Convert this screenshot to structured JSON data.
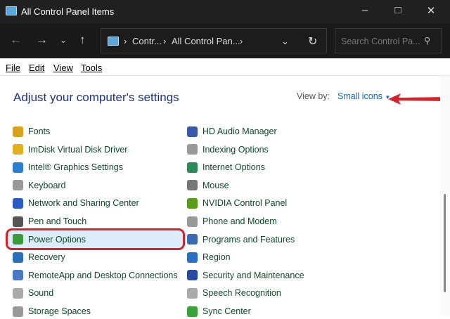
{
  "window": {
    "title": "All Control Panel Items"
  },
  "address": {
    "crumbs": [
      "Contr...",
      "All Control Pan..."
    ],
    "search_placeholder": "Search Control Pa..."
  },
  "menu": [
    "File",
    "Edit",
    "View",
    "Tools"
  ],
  "content": {
    "heading": "Adjust your computer's settings",
    "view_by_label": "View by:",
    "view_by_value": "Small icons"
  },
  "left_items": [
    {
      "label": "Fonts",
      "icon": "fonts-icon",
      "color": "#d9a21c"
    },
    {
      "label": "ImDisk Virtual Disk Driver",
      "icon": "imdisk-icon",
      "color": "#e0b020"
    },
    {
      "label": "Intel® Graphics Settings",
      "icon": "intel-graphics-icon",
      "color": "#2b7fd0"
    },
    {
      "label": "Keyboard",
      "icon": "keyboard-icon",
      "color": "#999999"
    },
    {
      "label": "Network and Sharing Center",
      "icon": "network-icon",
      "color": "#2a5bc0"
    },
    {
      "label": "Pen and Touch",
      "icon": "pen-icon",
      "color": "#555555"
    },
    {
      "label": "Power Options",
      "icon": "power-options-icon",
      "color": "#3c9a3c"
    },
    {
      "label": "Recovery",
      "icon": "recovery-icon",
      "color": "#2a70b8"
    },
    {
      "label": "RemoteApp and Desktop Connections",
      "icon": "remoteapp-icon",
      "color": "#4a7ac0"
    },
    {
      "label": "Sound",
      "icon": "sound-icon",
      "color": "#aaaaaa"
    },
    {
      "label": "Storage Spaces",
      "icon": "storage-icon",
      "color": "#999999"
    }
  ],
  "right_items": [
    {
      "label": "HD Audio Manager",
      "icon": "hd-audio-icon",
      "color": "#3a5aa8"
    },
    {
      "label": "Indexing Options",
      "icon": "indexing-icon",
      "color": "#999999"
    },
    {
      "label": "Internet Options",
      "icon": "internet-options-icon",
      "color": "#2a8a5a"
    },
    {
      "label": "Mouse",
      "icon": "mouse-icon",
      "color": "#777777"
    },
    {
      "label": "NVIDIA Control Panel",
      "icon": "nvidia-icon",
      "color": "#5a9a1a"
    },
    {
      "label": "Phone and Modem",
      "icon": "phone-modem-icon",
      "color": "#999999"
    },
    {
      "label": "Programs and Features",
      "icon": "programs-icon",
      "color": "#3a6ab0"
    },
    {
      "label": "Region",
      "icon": "region-icon",
      "color": "#2a70c0"
    },
    {
      "label": "Security and Maintenance",
      "icon": "security-flag-icon",
      "color": "#2a4aa0"
    },
    {
      "label": "Speech Recognition",
      "icon": "microphone-icon",
      "color": "#aaaaaa"
    },
    {
      "label": "Sync Center",
      "icon": "sync-icon",
      "color": "#3aa03a"
    }
  ]
}
